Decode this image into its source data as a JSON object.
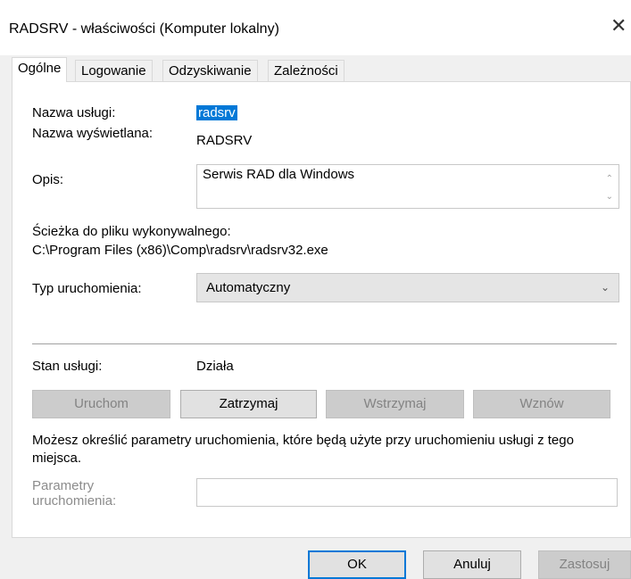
{
  "window": {
    "title": "RADSRV  - właściwości (Komputer lokalny)",
    "close_glyph": "✕"
  },
  "tabs": [
    {
      "label": "Ogólne",
      "active": true
    },
    {
      "label": "Logowanie",
      "active": false
    },
    {
      "label": "Odzyskiwanie",
      "active": false
    },
    {
      "label": "Zależności",
      "active": false
    }
  ],
  "general": {
    "service_name_label": "Nazwa usługi:",
    "service_name_value": "radsrv",
    "display_name_label": "Nazwa wyświetlana:",
    "display_name_value": "RADSRV",
    "description_label": "Opis:",
    "description_value": "Serwis RAD dla Windows",
    "path_label": "Ścieżka do pliku wykonywalnego:",
    "path_value": "C:\\Program Files (x86)\\Comp\\radsrv\\radsrv32.exe",
    "startup_type_label": "Typ uruchomienia:",
    "startup_type_value": "Automatyczny",
    "status_label": "Stan usługi:",
    "status_value": "Działa",
    "buttons": {
      "start": "Uruchom",
      "stop": "Zatrzymaj",
      "pause": "Wstrzymaj",
      "resume": "Wznów"
    },
    "params_info": "Możesz określić parametry uruchomienia, które będą użyte przy uruchomieniu usługi z tego miejsca.",
    "params_label": "Parametry uruchomienia:",
    "params_value": ""
  },
  "footer": {
    "ok": "OK",
    "cancel": "Anuluj",
    "apply": "Zastosuj"
  },
  "icons": {
    "scroll_up": "⌃",
    "scroll_down": "⌄",
    "dropdown": "⌄"
  }
}
